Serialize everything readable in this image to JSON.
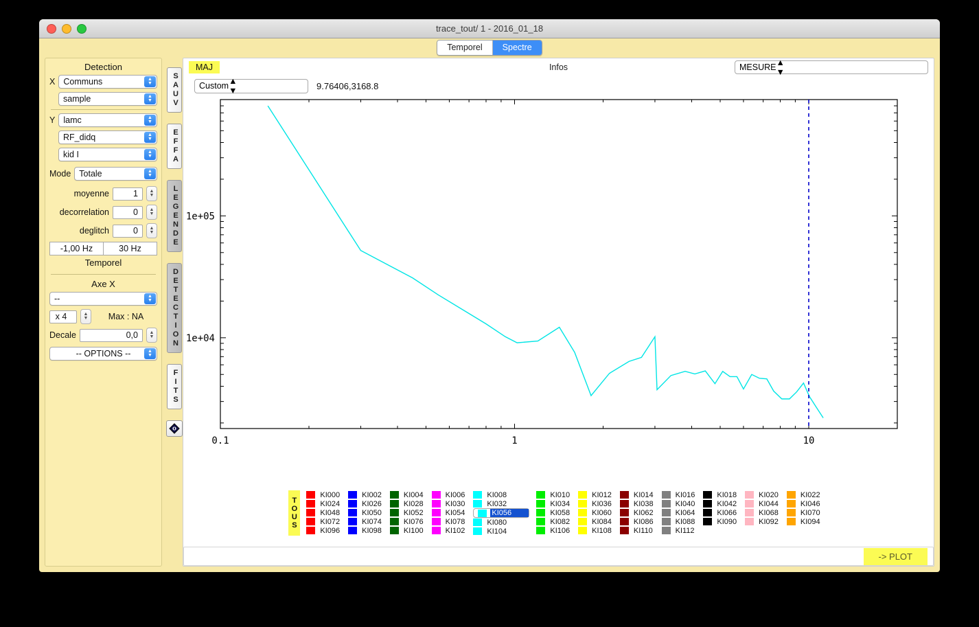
{
  "window": {
    "title": "trace_tout/ 1 - 2016_01_18",
    "traffic": {
      "close": "close-button",
      "minimize": "minimize-button",
      "zoom": "zoom-button"
    }
  },
  "tabs": [
    {
      "label": "Temporel",
      "active": false
    },
    {
      "label": "Spectre",
      "active": true
    }
  ],
  "detection": {
    "header": "Detection",
    "x_label": "X",
    "x_value": "Communs",
    "x_sub_value": "sample",
    "y_label": "Y",
    "y_value": "lamc",
    "y_sub1": "RF_didq",
    "y_sub2": "kid I",
    "mode_label": "Mode",
    "mode_value": "Totale",
    "moyenne_label": "moyenne",
    "moyenne_value": "1",
    "decorrelation_label": "decorrelation",
    "decorrelation_value": "0",
    "deglitch_label": "deglitch",
    "deglitch_value": "0",
    "freq_min": "-1,00 Hz",
    "freq_max": "30 Hz",
    "temporel_header": "Temporel",
    "axe_x_header": "Axe X",
    "axe_x_value": "--",
    "multiplier": "x 4",
    "max_label": "Max : NA",
    "decale_label": "Decale",
    "decale_value": "0,0",
    "options_value": "-- OPTIONS --"
  },
  "side_tabs": [
    {
      "label": "SAUV",
      "active": false
    },
    {
      "label": "EFFA",
      "active": false
    },
    {
      "label": "LEGENDE",
      "active": true
    },
    {
      "label": "DETECTION",
      "active": true
    },
    {
      "label": "FITS",
      "active": false
    }
  ],
  "side_icon": "diamond-icon",
  "infobar": {
    "maj": "MAJ",
    "infos": "Infos",
    "mesure": "MESURE"
  },
  "coordbar": {
    "custom": "Custom",
    "coords": "9.76406,3168.8"
  },
  "bottom": {
    "plot_button": "-> PLOT"
  },
  "legend": {
    "tous": "TOUS",
    "selected": "KI056",
    "columns": [
      {
        "color": "#ff0000",
        "items": [
          "KI000",
          "KI024",
          "KI048",
          "KI072",
          "KI096"
        ]
      },
      {
        "color": "#0000ff",
        "items": [
          "KI002",
          "KI026",
          "KI050",
          "KI074",
          "KI098"
        ]
      },
      {
        "color": "#006400",
        "items": [
          "KI004",
          "KI028",
          "KI052",
          "KI076",
          "KI100"
        ]
      },
      {
        "color": "#ff00ff",
        "items": [
          "KI006",
          "KI030",
          "KI054",
          "KI078",
          "KI102"
        ]
      },
      {
        "color": "#00ffff",
        "items": [
          "KI008",
          "KI032",
          "KI056",
          "KI080",
          "KI104"
        ]
      },
      {
        "color": "#00ee00",
        "items": [
          "KI010",
          "KI034",
          "KI058",
          "KI082",
          "KI106"
        ]
      },
      {
        "color": "#ffff00",
        "items": [
          "KI012",
          "KI036",
          "KI060",
          "KI084",
          "KI108"
        ]
      },
      {
        "color": "#8b0000",
        "items": [
          "KI014",
          "KI038",
          "KI062",
          "KI086",
          "KI110"
        ]
      },
      {
        "color": "#808080",
        "items": [
          "KI016",
          "KI040",
          "KI064",
          "KI088",
          "KI112"
        ]
      },
      {
        "color": "#000000",
        "items": [
          "KI018",
          "KI042",
          "KI066",
          "KI090"
        ]
      },
      {
        "color": "#ffb6c1",
        "items": [
          "KI020",
          "KI044",
          "KI068",
          "KI092"
        ]
      },
      {
        "color": "#ffa500",
        "items": [
          "KI022",
          "KI046",
          "KI070",
          "KI094"
        ]
      }
    ]
  },
  "chart_data": {
    "type": "line",
    "title": "",
    "xlabel": "",
    "ylabel": "",
    "xscale": "log",
    "yscale": "log",
    "xlim": [
      0.1,
      20
    ],
    "ylim": [
      1800,
      900000
    ],
    "xticklabels": [
      "0.1",
      "1",
      "10"
    ],
    "xtickvalues": [
      0.1,
      1,
      10
    ],
    "yticklabels": [
      "1e+05",
      "1e+04"
    ],
    "ytickvalues": [
      100000,
      10000
    ],
    "grid": false,
    "legend_position": "bottom",
    "marker_line": {
      "x": 10,
      "color": "#0000cc",
      "style": "dashed"
    },
    "series": [
      {
        "name": "KI056",
        "color": "#00e5e5",
        "x": [
          0.145,
          0.3,
          0.45,
          0.55,
          0.68,
          0.8,
          0.93,
          1.02,
          1.2,
          1.42,
          1.6,
          1.82,
          2.1,
          2.45,
          2.7,
          3.0,
          3.05,
          3.4,
          3.8,
          4.1,
          4.45,
          4.8,
          5.1,
          5.4,
          5.7,
          6.0,
          6.4,
          6.8,
          7.2,
          7.6,
          8.1,
          8.6,
          9.1,
          9.6,
          10.05,
          10.6,
          11.2
        ],
        "y": [
          800000,
          52000,
          31000,
          22500,
          16500,
          13000,
          10200,
          9100,
          9400,
          12200,
          7600,
          3350,
          5100,
          6400,
          6900,
          10200,
          3750,
          4900,
          5300,
          5050,
          5350,
          4200,
          5300,
          4800,
          4800,
          3800,
          5000,
          4650,
          4600,
          3650,
          3150,
          3150,
          3600,
          4250,
          3300,
          2700,
          2200
        ]
      }
    ]
  }
}
